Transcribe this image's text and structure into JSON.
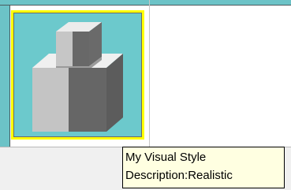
{
  "tooltip": {
    "title": "My Visual Style",
    "description": "Description:Realistic"
  },
  "style_tile": {
    "icon": "stacked-cubes-icon",
    "selected": true
  },
  "colors": {
    "tile_background": "#6cc9cc",
    "selection_border": "#ffff00",
    "tooltip_background": "#ffffe1"
  }
}
